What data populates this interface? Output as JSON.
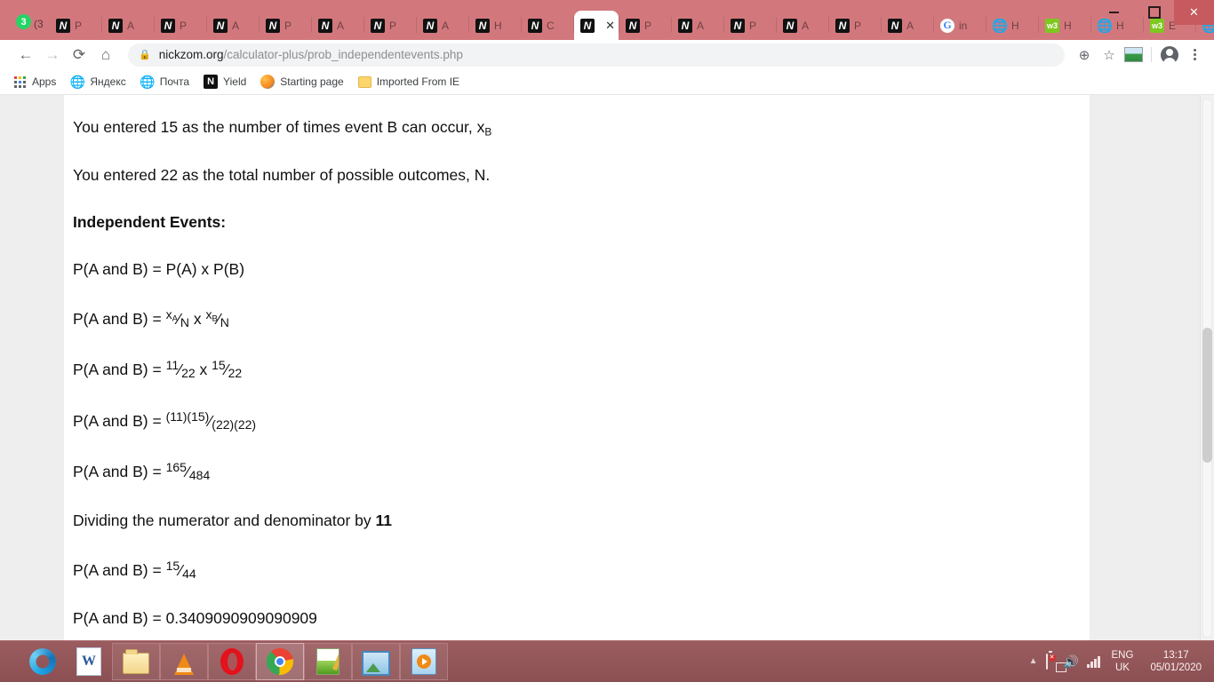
{
  "window": {
    "controls": {
      "minimize": "—",
      "maximize": "□",
      "close": "✕"
    }
  },
  "tabstrip": {
    "notification_badge": "3",
    "notification_label": "(3",
    "new_tab_label": "+",
    "close_label": "✕",
    "tabs": [
      {
        "icon": "nickzom-favicon",
        "glyph": "N",
        "title": "P",
        "active": false
      },
      {
        "icon": "nickzom-favicon",
        "glyph": "N",
        "title": "A",
        "active": false
      },
      {
        "icon": "nickzom-favicon",
        "glyph": "N",
        "title": "P",
        "active": false
      },
      {
        "icon": "nickzom-favicon",
        "glyph": "N",
        "title": "A",
        "active": false
      },
      {
        "icon": "nickzom-favicon",
        "glyph": "N",
        "title": "P",
        "active": false
      },
      {
        "icon": "nickzom-favicon",
        "glyph": "N",
        "title": "A",
        "active": false
      },
      {
        "icon": "nickzom-favicon",
        "glyph": "N",
        "title": "P",
        "active": false
      },
      {
        "icon": "nickzom-favicon",
        "glyph": "N",
        "title": "A",
        "active": false
      },
      {
        "icon": "nickzom-favicon",
        "glyph": "N",
        "title": "H",
        "active": false
      },
      {
        "icon": "nickzom-favicon",
        "glyph": "N",
        "title": "C",
        "active": false
      },
      {
        "icon": "nickzom-favicon",
        "glyph": "N",
        "title": "",
        "active": true
      },
      {
        "icon": "nickzom-favicon",
        "glyph": "N",
        "title": "P",
        "active": false
      },
      {
        "icon": "nickzom-favicon",
        "glyph": "N",
        "title": "A",
        "active": false
      },
      {
        "icon": "nickzom-favicon",
        "glyph": "N",
        "title": "P",
        "active": false
      },
      {
        "icon": "nickzom-favicon",
        "glyph": "N",
        "title": "A",
        "active": false
      },
      {
        "icon": "nickzom-favicon",
        "glyph": "N",
        "title": "P",
        "active": false
      },
      {
        "icon": "nickzom-favicon",
        "glyph": "N",
        "title": "A",
        "active": false
      },
      {
        "icon": "google-favicon",
        "glyph": "G",
        "title": "in",
        "active": false
      },
      {
        "icon": "globe-favicon",
        "glyph": "🌐",
        "title": "H",
        "active": false
      },
      {
        "icon": "w3-favicon",
        "glyph": "w3",
        "title": "H",
        "active": false
      },
      {
        "icon": "globe-favicon",
        "glyph": "🌐",
        "title": "H",
        "active": false
      },
      {
        "icon": "w3-favicon",
        "glyph": "w3",
        "title": "E",
        "active": false
      },
      {
        "icon": "globe-favicon",
        "glyph": "🌐",
        "title": "...",
        "active": false
      }
    ]
  },
  "toolbar": {
    "back_label": "←",
    "forward_label": "→",
    "reload_label": "⟳",
    "home_label": "⌂",
    "lock_label": "🔒",
    "url_host": "nickzom.org",
    "url_path": "/calculator-plus/prob_independentevents.php",
    "zoom_label": "⊕",
    "bookmark_star_label": "☆",
    "extension_label": "extension-icon",
    "profile_label": "profile-avatar",
    "menu_label": "⋮"
  },
  "bookmarks": [
    {
      "icon": "apps-grid-icon",
      "label": "Apps"
    },
    {
      "icon": "globe-icon",
      "label": "Яндекс"
    },
    {
      "icon": "globe-icon",
      "label": "Почта"
    },
    {
      "icon": "nickzom-icon",
      "label": "Yield"
    },
    {
      "icon": "starting-page-icon",
      "label": "Starting page"
    },
    {
      "icon": "folder-icon",
      "label": "Imported From IE"
    }
  ],
  "page": {
    "lines": [
      {
        "id": "line-entered-b",
        "type": "text",
        "text": "You entered 15 as the number of times event B can occur, x",
        "sub": "B"
      },
      {
        "id": "line-entered-n",
        "type": "text",
        "text": "You entered 22 as the total number of possible outcomes, N."
      },
      {
        "id": "line-heading",
        "type": "heading",
        "text": "Independent Events:"
      },
      {
        "id": "line-formula-1",
        "type": "text",
        "text": "P(A and B) = P(A) x P(B)"
      },
      {
        "id": "line-formula-2",
        "type": "frac2",
        "prefix": "P(A and B) = ",
        "num1": "xA",
        "den1": "N",
        "mid": " x ",
        "num2": "xB",
        "den2": "N"
      },
      {
        "id": "line-formula-3",
        "type": "frac2",
        "prefix": "P(A and B) = ",
        "num1": "11",
        "den1": "22",
        "mid": " x ",
        "num2": "15",
        "den2": "22"
      },
      {
        "id": "line-formula-4",
        "type": "frac1",
        "prefix": "P(A and B) = ",
        "num1": "(11)(15)",
        "den1": "(22)(22)"
      },
      {
        "id": "line-formula-5",
        "type": "frac1",
        "prefix": "P(A and B) = ",
        "num1": "165",
        "den1": "484"
      },
      {
        "id": "line-dividing",
        "type": "bold-tail",
        "prefix": "Dividing the numerator and denominator by ",
        "bold": "11"
      },
      {
        "id": "line-formula-6",
        "type": "frac1",
        "prefix": "P(A and B) = ",
        "num1": "15",
        "den1": "44"
      },
      {
        "id": "line-result",
        "type": "text",
        "text": "P(A and B) = 0.3409090909090909"
      }
    ],
    "fraction_slash": "⁄"
  },
  "taskbar": {
    "apps": [
      {
        "name": "internet-explorer",
        "active": false
      },
      {
        "name": "microsoft-word",
        "active": false
      },
      {
        "name": "file-explorer",
        "active": false
      },
      {
        "name": "vlc-media-player",
        "active": false
      },
      {
        "name": "opera-browser",
        "active": false
      },
      {
        "name": "google-chrome",
        "active": true
      },
      {
        "name": "notepad-plus-plus",
        "active": false
      },
      {
        "name": "photo-viewer",
        "active": false
      },
      {
        "name": "media-player",
        "active": false
      }
    ],
    "tray": {
      "show_hidden_label": "▲",
      "battery_label": "battery-icon",
      "network_label": "network-error-icon",
      "volume_label": "🔊",
      "signal_label": "signal-bars-icon",
      "language_line1": "ENG",
      "language_line2": "UK",
      "time": "13:17",
      "date": "05/01/2020"
    }
  },
  "colors": {
    "browser_frame": "#d2787d",
    "taskbar": "#9b5c5f",
    "page_background": "#ffffff",
    "viewport_background": "#eeeeee",
    "text": "#111111",
    "url_host": "#202124",
    "url_path": "#8b8f94"
  }
}
